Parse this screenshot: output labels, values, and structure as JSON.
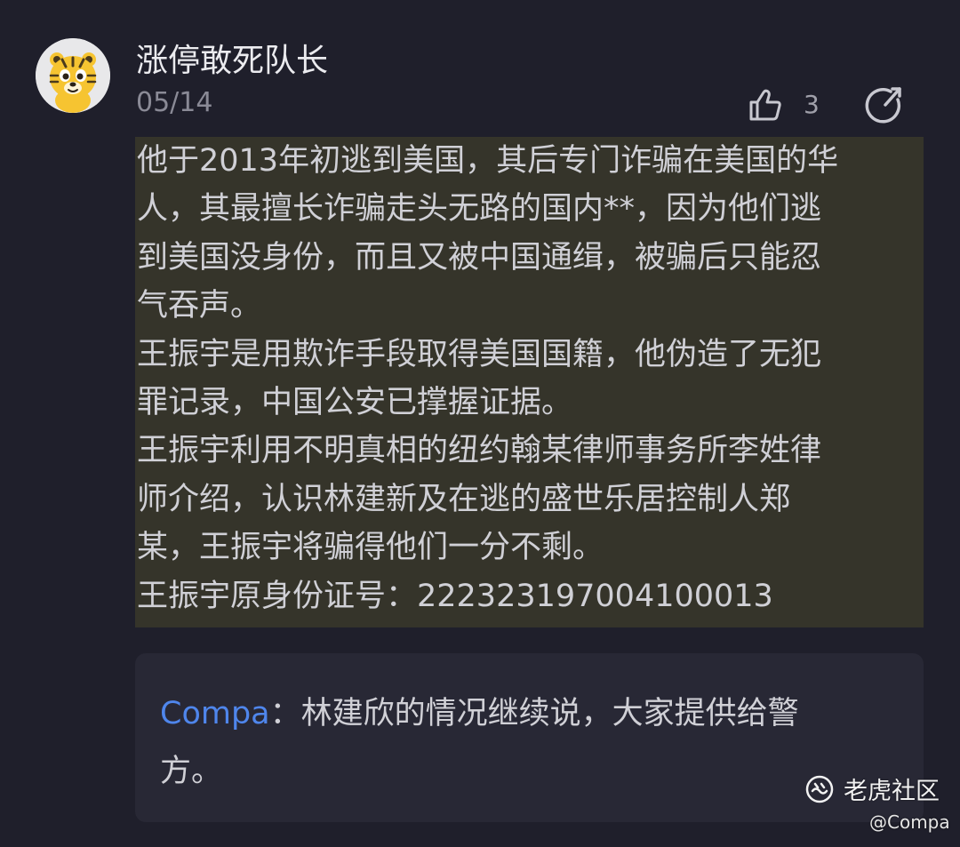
{
  "post": {
    "username": "涨停敢死队长",
    "date": "05/14",
    "likes": "3",
    "body_lines": [
      "他于2013年初逃到美国，其后专门诈骗在美国的华",
      "人，其最擅长诈骗走头无路的国内**，因为他们逃",
      "到美国没身份，而且又被中国通缉，被骗后只能忍",
      "气吞声。",
      "王振宇是用欺诈手段取得美国国籍，他伪造了无犯",
      "罪记录，中国公安已撑握证据。",
      "王振宇利用不明真相的纽约翰某律师事务所李姓律",
      "师介绍，认识林建新及在逃的盛世乐居控制人郑",
      "某，王振宇将骗得他们一分不剩。",
      "王振宇原身份证号：22232319700410 0013"
    ]
  },
  "reply": {
    "author": "Compa",
    "separator": "：",
    "line1": "林建欣的情况继续说，大家提供给警",
    "line2": "方。"
  },
  "watermark": {
    "brand": "老虎社区",
    "handle": "@Compa"
  },
  "icons": {
    "avatar": "tiger-avatar-icon",
    "like": "thumbs-up-icon",
    "share": "share-icon",
    "watermark_logo": "tiger-logo-icon"
  },
  "colors": {
    "background": "#1f1f2b",
    "highlight": "#35342a",
    "reply_card": "#282835",
    "author_link": "#4f86ec"
  }
}
